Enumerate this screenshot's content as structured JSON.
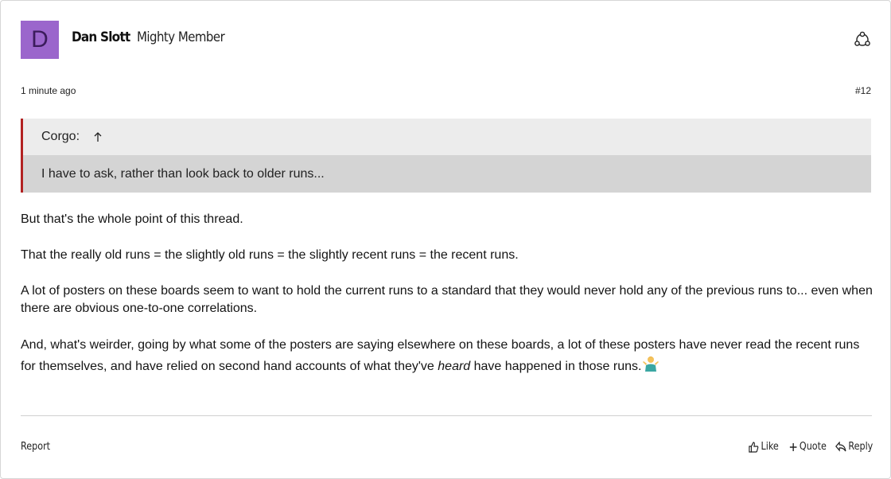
{
  "post": {
    "avatar_letter": "D",
    "author_name": "Dan Slott",
    "author_rank": "Mighty Member",
    "time_ago": "1 minute ago",
    "post_number": "#12",
    "quote": {
      "author": "Corgo:",
      "text": "I have to ask, rather than look back to older runs..."
    },
    "body": {
      "p1": "But that's the whole point of this thread.",
      "p2": "That the really old runs = the slightly old runs = the slightly recent runs = the recent runs.",
      "p3": "A lot of posters on these boards seem to want to hold the current runs to a standard that they would never hold any of the previous runs to... even when there are obvious one-to-one correlations.",
      "p4_before": "And, what's weirder, going by what some of the posters are saying elsewhere on these boards, a lot of these posters have never read the recent runs for themselves, and have relied on second hand accounts of what they've ",
      "p4_emph": "heard",
      "p4_after": " have happened in those runs."
    },
    "emoji": "person-shrugging",
    "footer": {
      "report_label": "Report",
      "like_label": "Like",
      "quote_label": "Quote",
      "reply_label": "Reply"
    }
  },
  "colors": {
    "avatar_bg": "#9b66cc",
    "quote_border": "#b22222",
    "quote_head_bg": "#ececec",
    "quote_body_bg": "#d4d4d4"
  }
}
